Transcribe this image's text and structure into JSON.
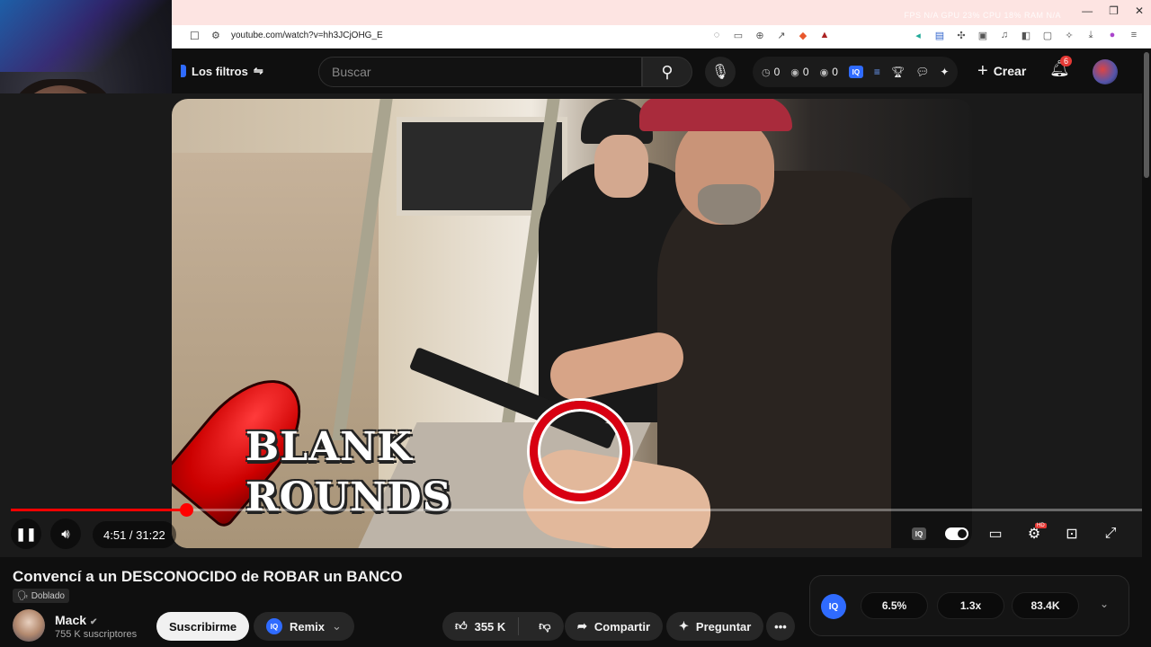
{
  "browser": {
    "url": "youtube.com/watch?v=hh3JCjOHG_E",
    "stats": "FPS  N/A      GPU  23%      CPU  18%      RAM  N/A"
  },
  "header": {
    "filters_label": "Los filtros",
    "search_placeholder": "Buscar",
    "stats": [
      "0",
      "0",
      "0"
    ],
    "create_label": "Crear",
    "notification_count": "6"
  },
  "video": {
    "overlay_line1": "BLANK",
    "overlay_line2": "ROUNDS"
  },
  "player": {
    "time": "4:51 / 31:22",
    "progress": 0.155
  },
  "details": {
    "title": "Convencí a un DESCONOCIDO de ROBAR un BANCO",
    "dubbed_label": "Doblado",
    "channel_name": "Mack",
    "subscribers": "755 K suscriptores",
    "subscribe_label": "Suscribirme",
    "remix_label": "Remix",
    "likes": "355 K",
    "share_label": "Compartir",
    "ask_label": "Preguntar"
  },
  "extension_stats": {
    "values": [
      "6.5%",
      "1.3x",
      "83.4K"
    ]
  },
  "colors": {
    "accent": "#ff0000",
    "extension_blue": "#2f6bff"
  }
}
